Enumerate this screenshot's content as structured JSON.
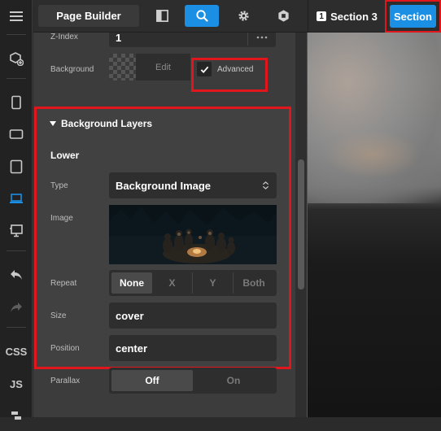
{
  "top_bar": {
    "page_builder_label": "Page Builder",
    "section3_badge": "1",
    "section3_label": "Section 3",
    "section_button_label": "Section"
  },
  "left_bar": {
    "css_label": "CSS",
    "js_label": "JS"
  },
  "panel": {
    "z_index": {
      "label": "Z-Index",
      "value": "1",
      "more_icon": "ellipsis-icon"
    },
    "background": {
      "label": "Background",
      "edit_label": "Edit",
      "advanced_label": "Advanced",
      "advanced_checked": true
    },
    "background_layers": {
      "title": "Background Layers",
      "layer_name": "Lower",
      "type": {
        "label": "Type",
        "value": "Background Image"
      },
      "image": {
        "label": "Image"
      },
      "repeat": {
        "label": "Repeat",
        "options": [
          "None",
          "X",
          "Y",
          "Both"
        ],
        "selected": "None"
      },
      "size": {
        "label": "Size",
        "value": "cover"
      },
      "position": {
        "label": "Position",
        "value": "center"
      }
    },
    "parallax": {
      "label": "Parallax",
      "options": [
        "Off",
        "On"
      ],
      "selected": "Off"
    }
  },
  "colors": {
    "accent": "#1a8fe3",
    "highlight": "#e0161c"
  }
}
